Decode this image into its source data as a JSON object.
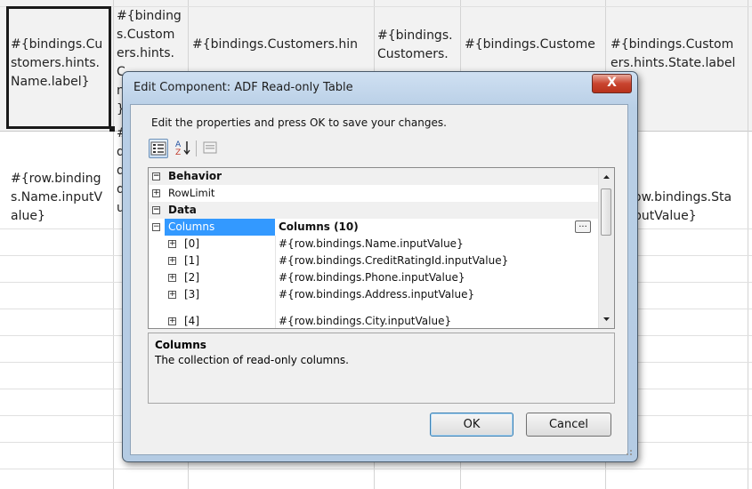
{
  "sheet": {
    "header_cells": [
      "#{bindings.Cu\nstomers.hints.\nName.label}",
      "#{binding\ns.Custom\ners.hints.\nC\nn\n}",
      "#{bindings.Customers.hin",
      "#{bindings.\nCustomers.",
      "#{bindings.Custome",
      "#{bindings.Custom\ners.hints.State.label"
    ],
    "row_cells": [
      "#{row.binding\ns.Name.inputV\nalue}",
      "#\nd\nd\nd\nu",
      "ow.bindings.Sta\nputValue}"
    ]
  },
  "dialog": {
    "title": "Edit Component: ADF Read-only Table",
    "close_label": "X",
    "instructions": "Edit the properties and press OK to save your changes.",
    "toolbar": {
      "categorized_icon": "categorized-icon",
      "sort_az_label": "A↓Z",
      "pages_icon": "property-pages-icon"
    },
    "grid": {
      "rows": [
        {
          "kind": "category",
          "expander": "⊟",
          "name": "Behavior",
          "value": ""
        },
        {
          "kind": "prop",
          "expander": "⊞",
          "name": "RowLimit",
          "value": ""
        },
        {
          "kind": "category",
          "expander": "⊟",
          "name": "Data",
          "value": ""
        },
        {
          "kind": "selected",
          "expander": "⊟",
          "name": "Columns",
          "value": "Columns (10)"
        },
        {
          "kind": "sub",
          "expander": "⊞",
          "name": "[0]",
          "value": "#{row.bindings.Name.inputValue}"
        },
        {
          "kind": "sub",
          "expander": "⊞",
          "name": "[1]",
          "value": "#{row.bindings.CreditRatingId.inputValue}"
        },
        {
          "kind": "sub",
          "expander": "⊞",
          "name": "[2]",
          "value": "#{row.bindings.Phone.inputValue}"
        },
        {
          "kind": "sub",
          "expander": "⊞",
          "name": "[3]",
          "value": "#{row.bindings.Address.inputValue}"
        },
        {
          "kind": "sub",
          "expander": "⊞",
          "name": "[4]",
          "value": "#{row.bindings.City.inputValue}"
        }
      ],
      "ellipsis_label": "..."
    },
    "description": {
      "heading": "Columns",
      "text": "The collection of read-only columns."
    },
    "ok_label": "OK",
    "cancel_label": "Cancel"
  }
}
